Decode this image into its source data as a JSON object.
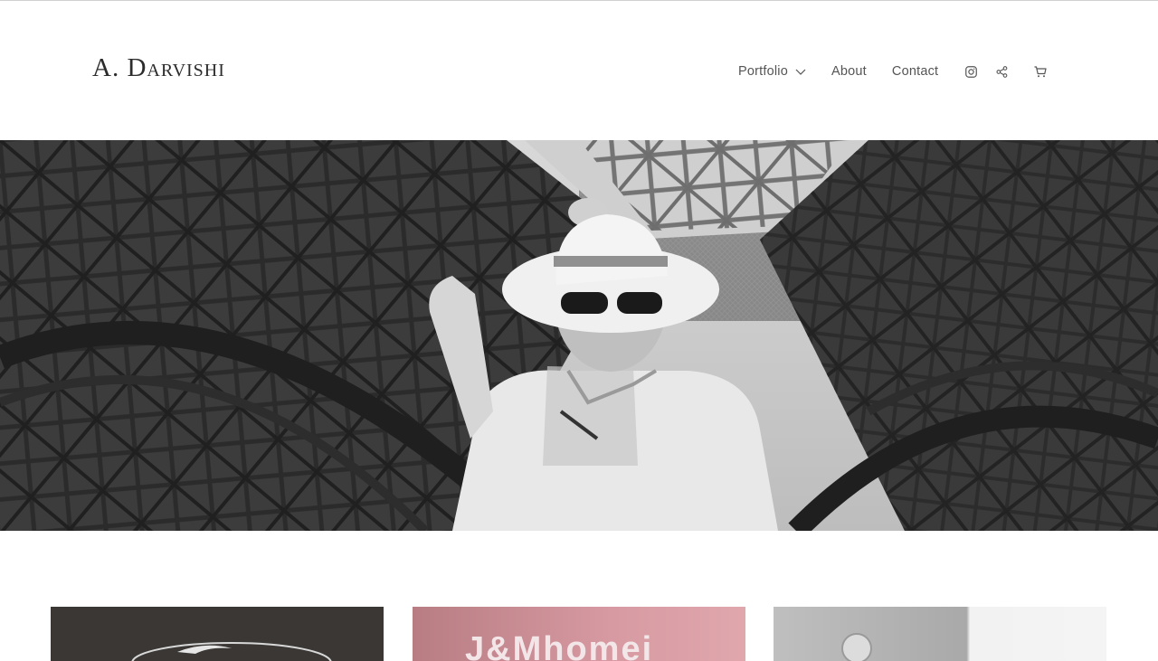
{
  "brand": {
    "name": "A. Darvishi"
  },
  "nav": {
    "portfolio": "Portfolio",
    "about": "About",
    "contact": "Contact"
  },
  "icons": {
    "dropdown": "chevron-down-icon",
    "instagram": "instagram-icon",
    "share": "share-icon",
    "cart": "cart-icon"
  },
  "hero": {
    "description": "Black and white photo of a man in a white hat and sunglasses under the iron lattice arches of the Eiffel Tower"
  },
  "projects": [
    {
      "text": ""
    },
    {
      "text": "J&Mhomei"
    },
    {
      "text": ""
    }
  ],
  "colors": {
    "text": "#2c2c2c",
    "nav": "#555555",
    "background": "#ffffff"
  }
}
